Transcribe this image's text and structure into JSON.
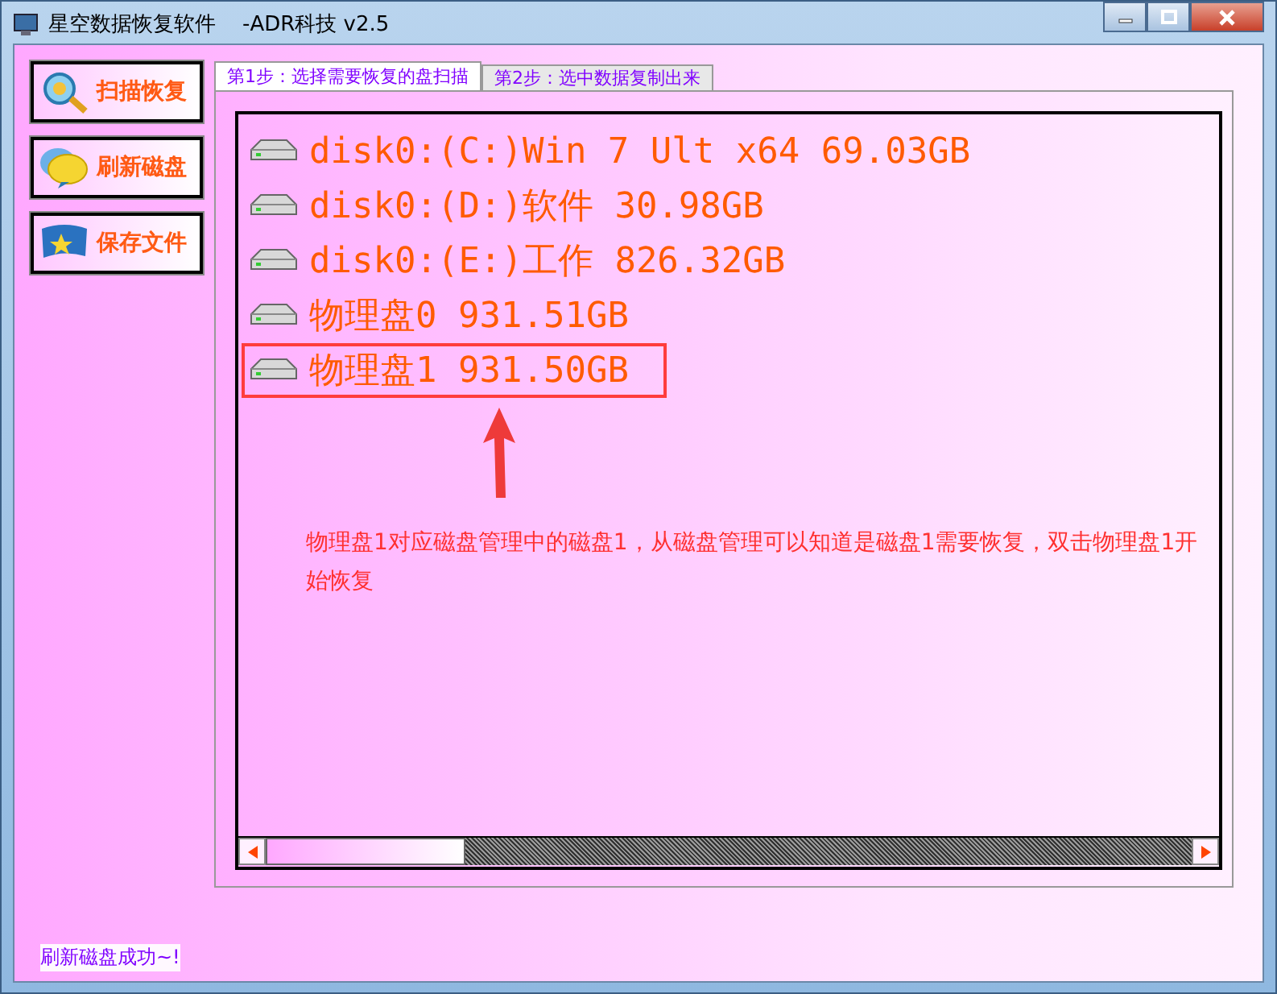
{
  "window": {
    "title": "星空数据恢复软件    -ADR科技 v2.5"
  },
  "side_buttons": [
    {
      "label": "扫描恢复",
      "kind": "scan"
    },
    {
      "label": "刷新磁盘",
      "kind": "refresh"
    },
    {
      "label": "保存文件",
      "kind": "save"
    }
  ],
  "tabs": [
    {
      "label": "第1步：选择需要恢复的盘扫描",
      "selected": true
    },
    {
      "label": "第2步：选中数据复制出来",
      "selected": false
    }
  ],
  "disks": [
    {
      "label": "disk0:(C:)Win 7 Ult x64 69.03GB",
      "highlighted": false
    },
    {
      "label": "disk0:(D:)软件 30.98GB",
      "highlighted": false
    },
    {
      "label": "disk0:(E:)工作 826.32GB",
      "highlighted": false
    },
    {
      "label": "物理盘0 931.51GB",
      "highlighted": false
    },
    {
      "label": "物理盘1 931.50GB",
      "highlighted": true
    }
  ],
  "annotation": "物理盘1对应磁盘管理中的磁盘1，从磁盘管理可以知道是磁盘1需要恢复，双击物理盘1开始恢复",
  "status_bar": "刷新磁盘成功~!"
}
